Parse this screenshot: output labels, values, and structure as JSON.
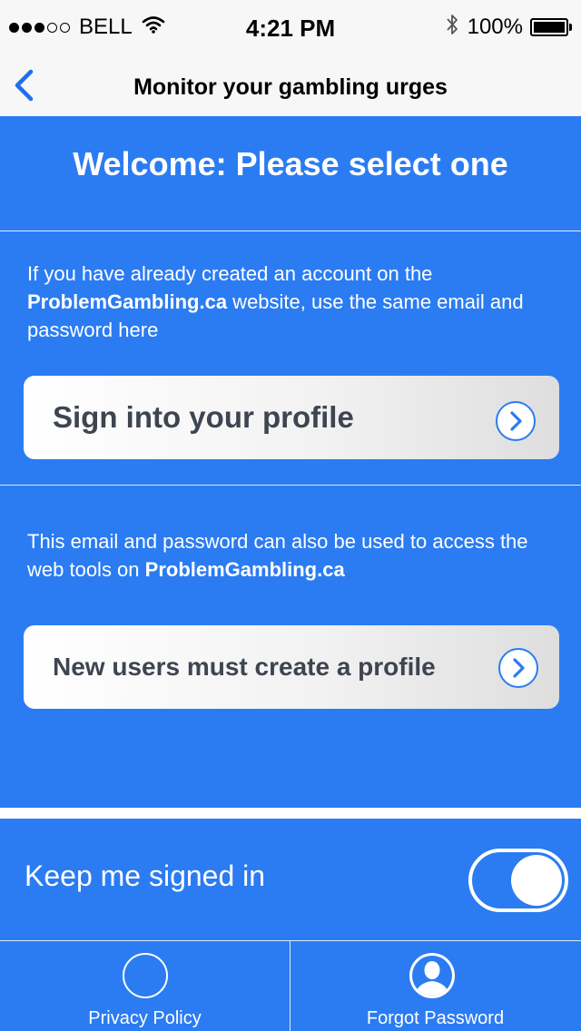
{
  "status_bar": {
    "carrier": "BELL",
    "time": "4:21 PM",
    "battery": "100%",
    "signal_bars": 3,
    "signal_total": 5,
    "icons": [
      "wifi-icon",
      "bluetooth-icon",
      "battery-icon"
    ]
  },
  "nav": {
    "title": "Monitor your gambling urges",
    "back_icon": "chevron-left-icon"
  },
  "welcome": {
    "title": "Welcome: Please select one"
  },
  "signin_section": {
    "text_before": "If you have already created an account on the ",
    "brand": "ProblemGambling.ca",
    "text_after": " website, use the same email and password here",
    "button_label": "Sign into your profile",
    "button_icon": "chevron-right-circle-icon"
  },
  "create_section": {
    "text_before": "This email and password can also be used to access the web tools on ",
    "brand": "ProblemGambling.ca",
    "text_after": "",
    "button_label": "New users must create a profile",
    "button_icon": "chevron-right-circle-icon"
  },
  "keep_signed_in": {
    "label": "Keep me signed in",
    "on": true
  },
  "tabs": [
    {
      "label": "Privacy Policy",
      "icon": "circle-icon"
    },
    {
      "label": "Forgot Password",
      "icon": "user-icon"
    }
  ],
  "colors": {
    "primary_blue": "#2b7cf2",
    "card_text": "#3e4550",
    "nav_background": "#f7f7f7"
  }
}
